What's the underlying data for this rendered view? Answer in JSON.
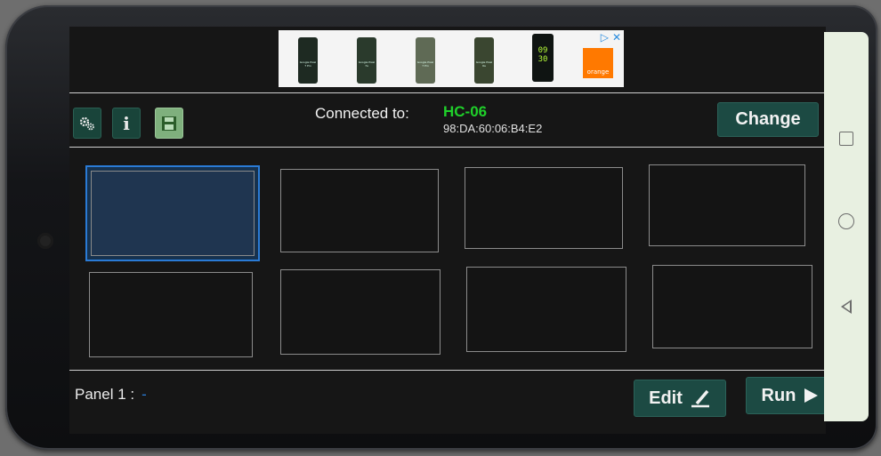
{
  "ad": {
    "products": [
      {
        "label": "Google Pixel 7 Pro"
      },
      {
        "label": "Google Pixel 7a"
      },
      {
        "label": "Google Pixel 7 Pro"
      },
      {
        "label": "Google Pixel 6a"
      }
    ],
    "clock": "09\n30",
    "brand": "orange"
  },
  "header": {
    "connected_label": "Connected to:",
    "device_name": "HC-06",
    "device_mac": "98:DA:60:06:B4:E2",
    "change_label": "Change",
    "info_label": "i"
  },
  "panels": {
    "count": 8,
    "selected_index": 0
  },
  "footer": {
    "panel_label": "Panel 1 :",
    "panel_value": "-",
    "edit_label": "Edit",
    "run_label": "Run"
  },
  "colors": {
    "accent_green": "#1fd12a",
    "button_bg": "#1c4a43",
    "selected_border": "#2a7bd6"
  }
}
